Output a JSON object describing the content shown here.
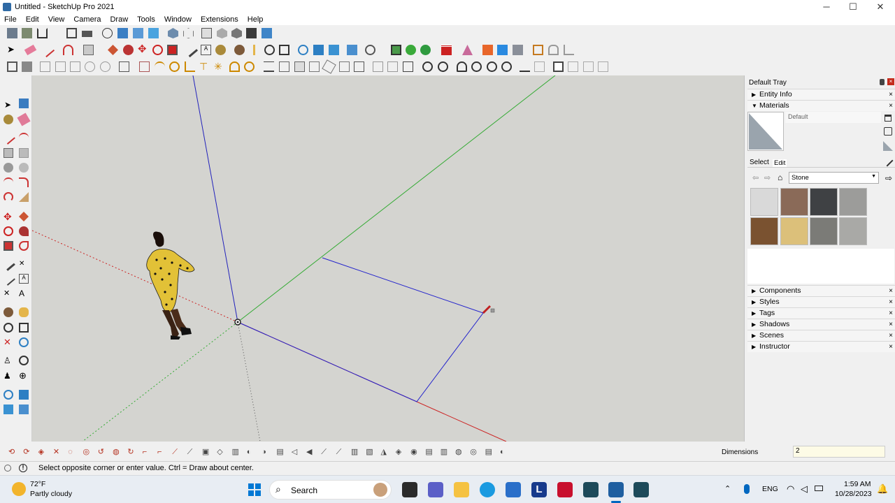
{
  "window": {
    "title": "Untitled - SketchUp Pro 2021",
    "minimize": "─",
    "maximize": "☐",
    "close": "✕"
  },
  "menu": [
    "File",
    "Edit",
    "View",
    "Camera",
    "Draw",
    "Tools",
    "Window",
    "Extensions",
    "Help"
  ],
  "tray": {
    "title": "Default Tray",
    "entity_info": "Entity Info",
    "materials": {
      "label": "Materials",
      "preview_name": "Default",
      "tab_select": "Select",
      "tab_edit": "Edit",
      "library": "Stone",
      "swatches": [
        "#d9d9d9",
        "#8a6a58",
        "#3f4144",
        "#9c9c9a",
        "#7a5230",
        "#dcc07a",
        "#7b7b77",
        "#a9a9a6"
      ]
    },
    "panels": [
      "Components",
      "Styles",
      "Tags",
      "Shadows",
      "Scenes",
      "Instructor"
    ],
    "close_glyph": "×",
    "collapsed_glyph": "▶",
    "expanded_glyph": "▼"
  },
  "measurements": {
    "label": "Dimensions",
    "value": "2"
  },
  "status": {
    "message": "Select opposite corner or enter value. Ctrl = Draw about center."
  },
  "taskbar": {
    "weather_temp": "72°F",
    "weather_desc": "Partly cloudy",
    "search_label": "Search",
    "language": "ENG",
    "time": "1:59 AM",
    "date": "10/28/2023",
    "app_l": "L"
  },
  "colors": {
    "viewport_bg": "#d4d4d0",
    "red_axis": "#cc2222",
    "green_axis": "#33aa33",
    "blue_axis": "#2222bb",
    "accent": "#0067c0"
  }
}
